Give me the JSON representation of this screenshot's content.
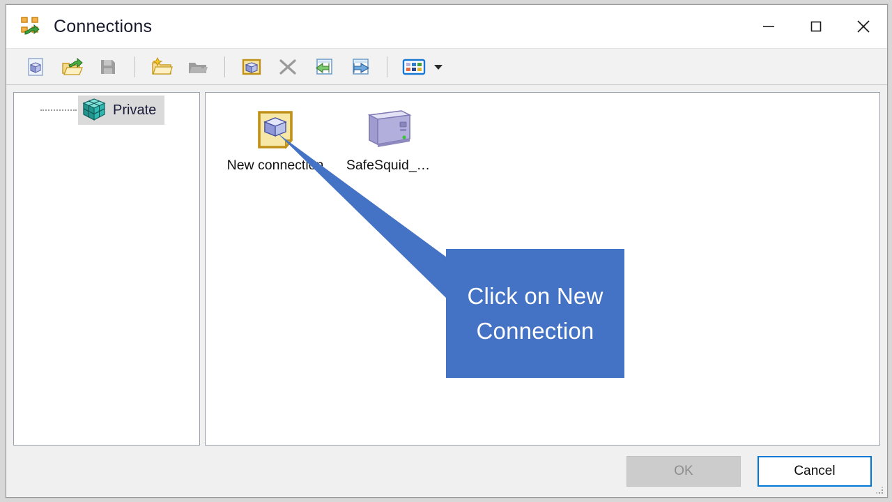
{
  "window": {
    "title": "Connections",
    "icon": "network-connections-icon",
    "controls": {
      "minimize": "minimize-icon",
      "maximize": "maximize-icon",
      "close": "close-icon"
    }
  },
  "toolbar": {
    "items": [
      {
        "name": "new-connection-button",
        "icon": "new-document-icon",
        "tooltip": "New",
        "enabled": true
      },
      {
        "name": "open-button",
        "icon": "open-folder-icon",
        "tooltip": "Open",
        "enabled": true
      },
      {
        "name": "save-button",
        "icon": "save-icon",
        "tooltip": "Save",
        "enabled": false
      },
      {
        "name": "new-folder-button",
        "icon": "new-folder-icon",
        "tooltip": "New folder",
        "enabled": true
      },
      {
        "name": "rename-folder-button",
        "icon": "folder-icon",
        "tooltip": "Rename",
        "enabled": false
      },
      {
        "name": "connect-button",
        "icon": "connection-icon",
        "tooltip": "Connect",
        "enabled": true
      },
      {
        "name": "delete-button",
        "icon": "delete-x-icon",
        "tooltip": "Delete",
        "enabled": false
      },
      {
        "name": "import-button",
        "icon": "import-arrow-icon",
        "tooltip": "Import",
        "enabled": true
      },
      {
        "name": "export-button",
        "icon": "export-arrow-icon",
        "tooltip": "Export",
        "enabled": true
      },
      {
        "name": "views-button",
        "icon": "views-grid-icon",
        "tooltip": "Views",
        "enabled": true
      },
      {
        "name": "views-dropdown-button",
        "icon": "chevron-down-icon",
        "tooltip": "More views",
        "enabled": true
      }
    ]
  },
  "tree": {
    "items": [
      {
        "label": "Private",
        "icon": "teal-cube-icon",
        "selected": true
      }
    ]
  },
  "list": {
    "items": [
      {
        "label": "New connection",
        "icon": "new-connection-page-icon"
      },
      {
        "label": "SafeSquid_…",
        "icon": "server-tower-icon"
      }
    ]
  },
  "footer": {
    "ok_label": "OK",
    "ok_enabled": false,
    "cancel_label": "Cancel",
    "cancel_default": true,
    "resize_grip": "resize-grip-icon"
  },
  "annotation": {
    "text": "Click on New Connection",
    "line1": "Click on New",
    "line2": "Connection",
    "color": "#4472C4",
    "text_color": "#ffffff",
    "pointer_target": "new-connection-page-icon"
  }
}
